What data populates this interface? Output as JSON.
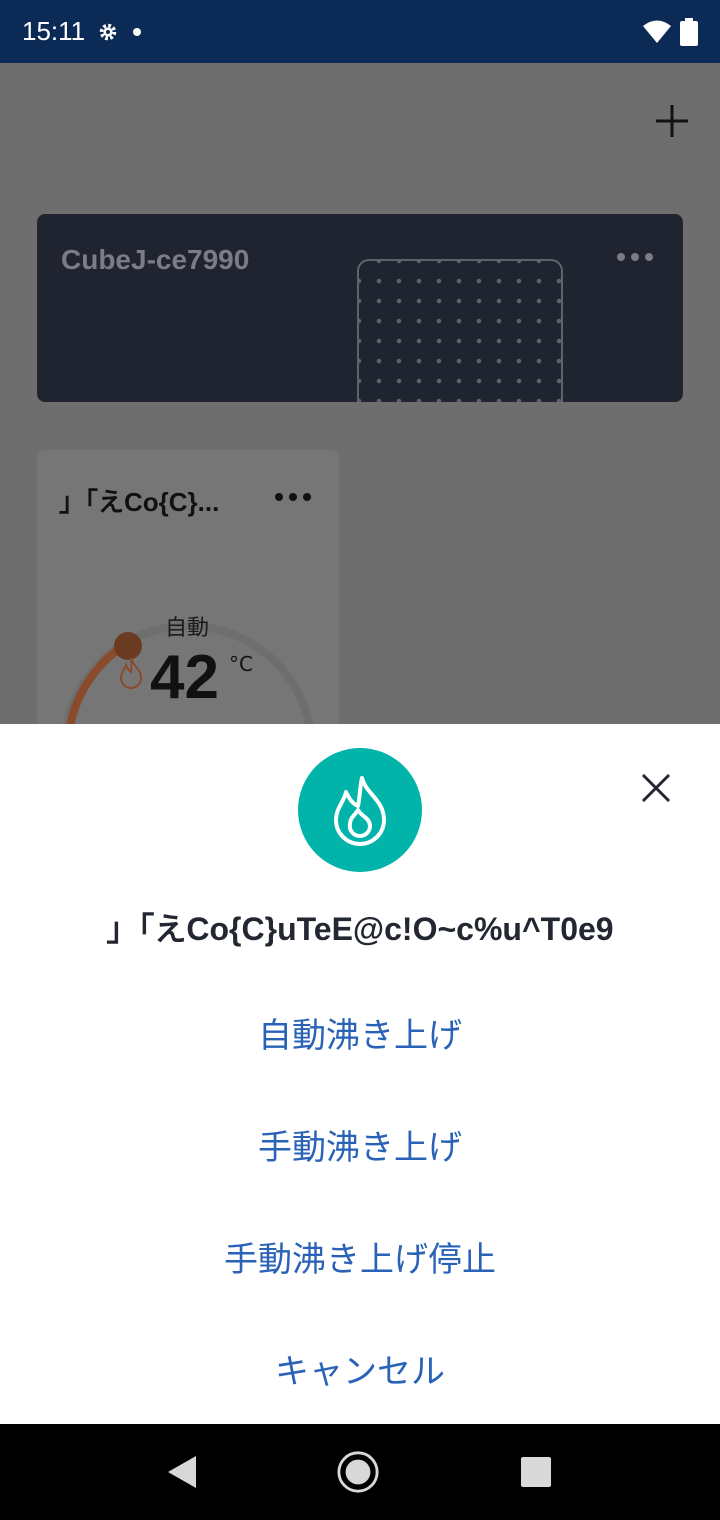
{
  "status_bar": {
    "time": "15:11",
    "icons": [
      "gear-icon",
      "notification-dot",
      "wifi-icon",
      "battery-icon"
    ]
  },
  "home": {
    "add_icon": "plus-icon",
    "hub_card": {
      "name": "CubeJ-ce7990",
      "menu_icon": "more-horizontal-icon"
    },
    "device_card": {
      "name": "」「えCo{C}...",
      "menu_icon": "more-horizontal-icon",
      "mode": "自動",
      "temperature": "42",
      "unit": "°C",
      "accent_color": "#c0501f"
    }
  },
  "sheet": {
    "icon": "flame-icon",
    "icon_color": "#00b4a9",
    "title": "」「えCo{C}uTeE@c!O~c%u^T0e9",
    "options": [
      "自動沸き上げ",
      "手動沸き上げ",
      "手動沸き上げ停止",
      "キャンセル"
    ],
    "option_color": "#2a62b8"
  },
  "nav_bar": {
    "icons": [
      "back-icon",
      "home-icon",
      "recents-icon"
    ]
  }
}
